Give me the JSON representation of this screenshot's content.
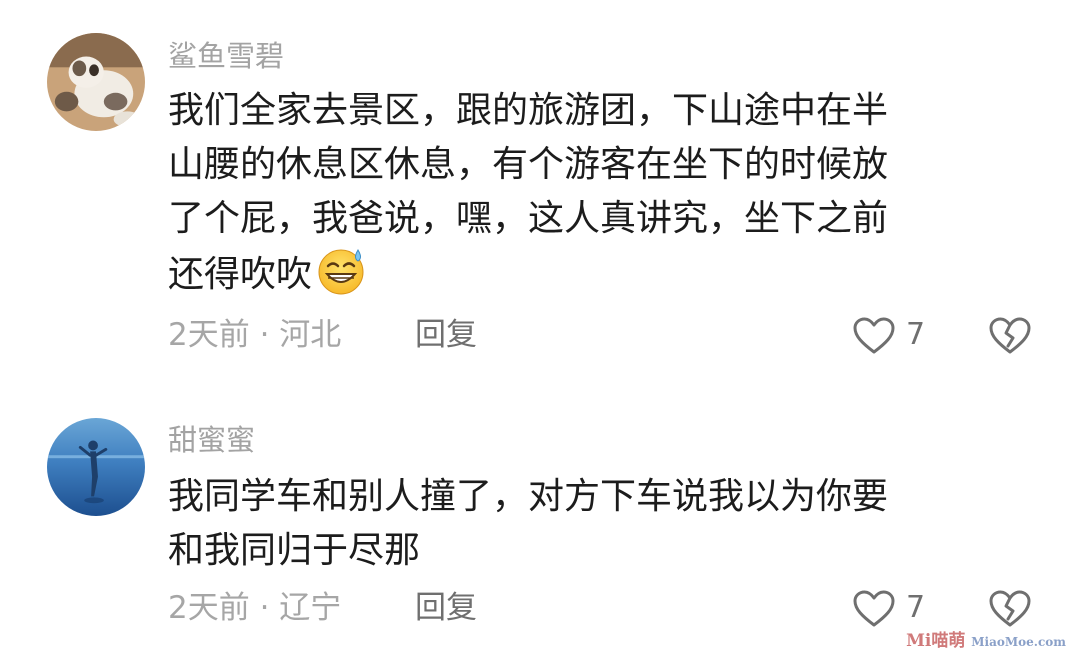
{
  "comments": [
    {
      "username": "鲨鱼雪碧",
      "avatar_icon": "cat-photo-avatar",
      "lines": [
        "我们全家去景区，跟的旅游团，下山途中在半",
        "山腰的休息区休息，有个游客在坐下的时候放",
        "了个屁，我爸说，嘿，这人真讲究，坐下之前",
        "还得吹吹"
      ],
      "emoji": "grinning-sweat-emoji",
      "meta": "2天前 · 河北",
      "reply_label": "回复",
      "like_count": "7",
      "like_icon": "heart-outline-icon",
      "dislike_icon": "broken-heart-icon"
    },
    {
      "username": "甜蜜蜜",
      "avatar_icon": "blue-water-figure-avatar",
      "lines": [
        "我同学车和别人撞了，对方下车说我以为你要",
        "和我同归于尽那"
      ],
      "meta": "2天前 · 辽宁",
      "reply_label": "回复",
      "like_count": "7",
      "like_icon": "heart-outline-icon",
      "dislike_icon": "broken-heart-icon"
    }
  ],
  "watermark": {
    "text": "Mi喵萌",
    "subtext": "MiaoMoe.com"
  },
  "colors": {
    "username": "#a3a3a3",
    "content": "#1c1c1c",
    "meta": "#a6a6a6",
    "action": "#6f6f6f"
  }
}
